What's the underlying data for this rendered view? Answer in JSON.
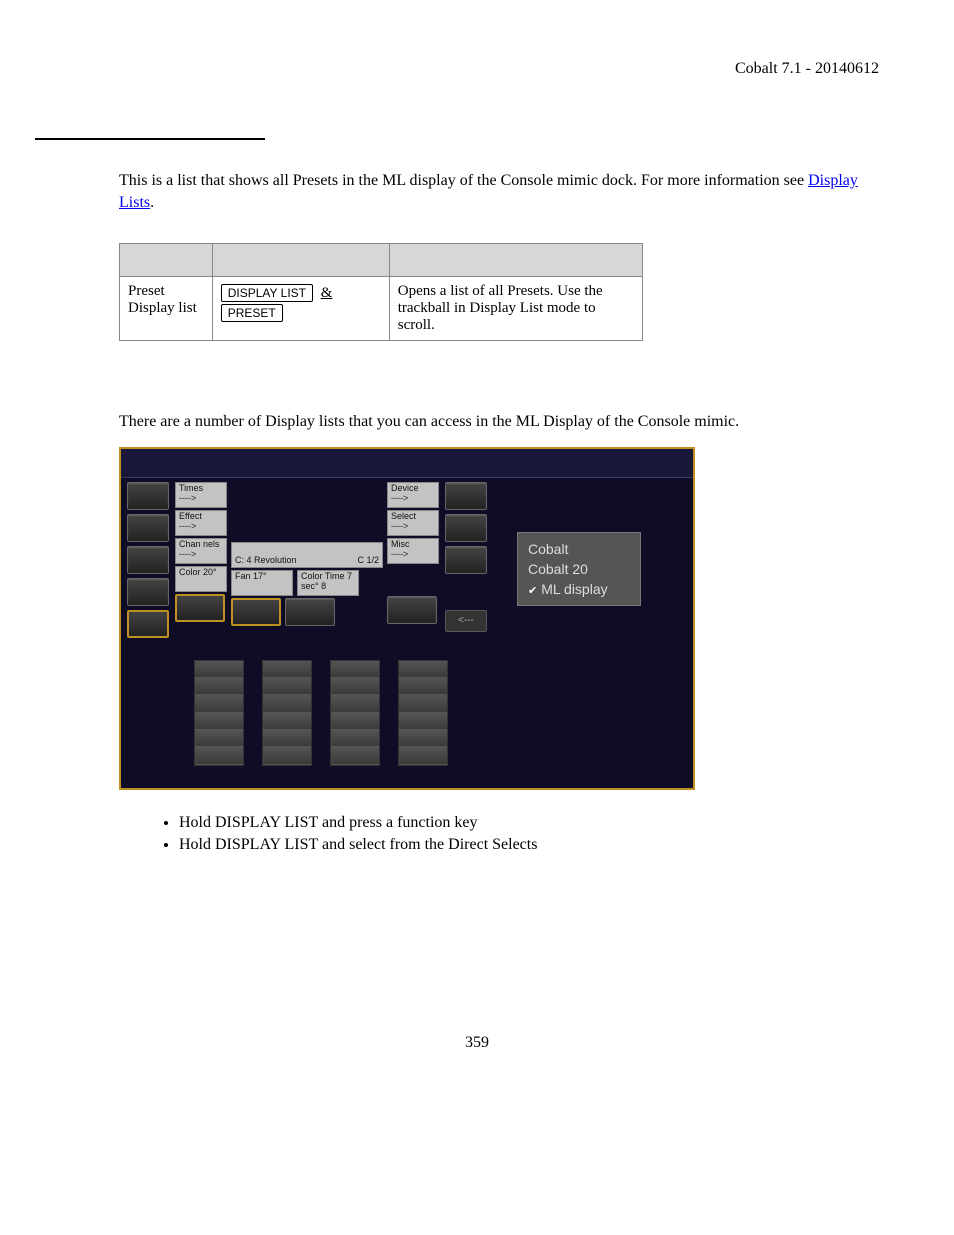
{
  "header": {
    "title": "Cobalt 7.1 - 20140612"
  },
  "intro": {
    "text_a": "This is a list that shows all Presets in the ML display of the Console mimic dock. For more information see ",
    "link": "Display Lists",
    "text_b": "."
  },
  "table": {
    "row1": {
      "action": "Preset Display list",
      "key1": "DISPLAY LIST",
      "amp": "&",
      "key2": "PRESET",
      "desc": "Opens a list of all Presets. Use the trackball in Display List mode to scroll."
    }
  },
  "section2": {
    "intro": "There are a number of Display lists that you can access in the ML Display of the Console mimic."
  },
  "mimic": {
    "left_labels": {
      "r1": "Times",
      "r2": "Effect",
      "r3": "Chan nels",
      "r4": "Color 20°",
      "arrow": "---->"
    },
    "center": {
      "main": "C:  4 Revolution",
      "main_right": "C 1/2",
      "fan": "Fan 17°",
      "ctime": "Color Time 7 sec° 8"
    },
    "right_labels": {
      "r1": "Device",
      "r2": "Select",
      "r3": "Misc",
      "arrow": "---->"
    },
    "back_arrow": "<---",
    "menu": {
      "i1": "Cobalt",
      "i2": "Cobalt 20",
      "i3": "ML display"
    }
  },
  "bullets": {
    "b1": "Hold DISPLAY LIST and press a function key",
    "b2": "Hold DISPLAY LIST and select from the Direct Selects"
  },
  "page_number": "359"
}
